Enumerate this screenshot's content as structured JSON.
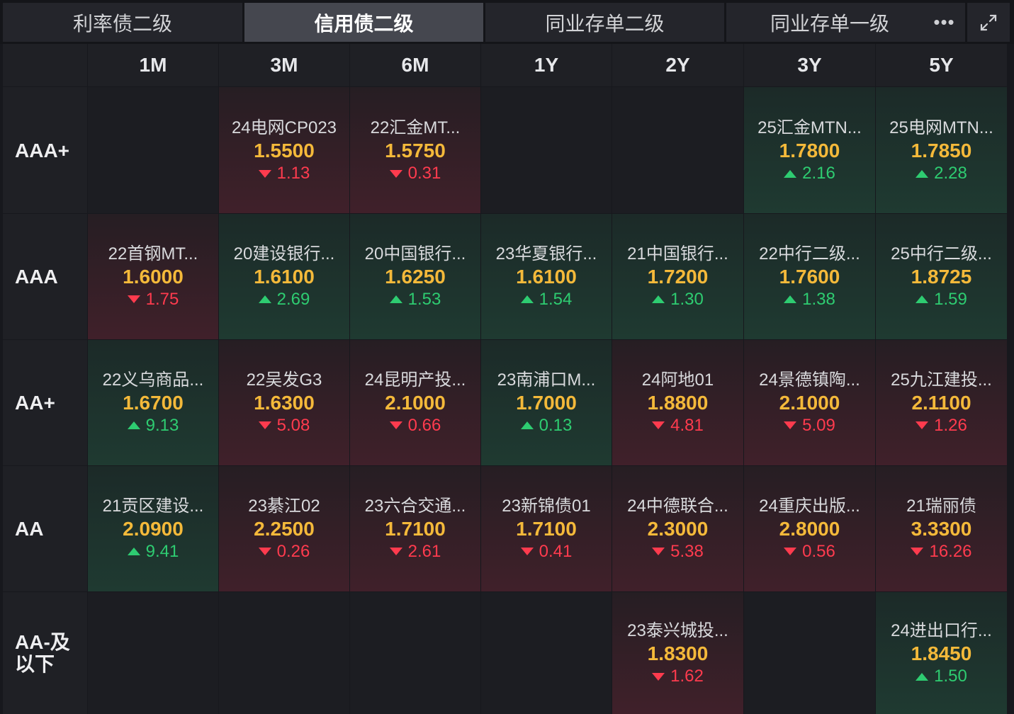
{
  "tabs": [
    "利率债二级",
    "信用债二级",
    "同业存单二级",
    "同业存单一级"
  ],
  "active_tab": 1,
  "more_label": "•••",
  "columns": [
    "1M",
    "3M",
    "6M",
    "1Y",
    "2Y",
    "3Y",
    "5Y"
  ],
  "rows": [
    {
      "label": "AAA+",
      "cells": [
        null,
        {
          "name": "24电网CP023",
          "value": "1.5500",
          "change": "1.13",
          "dir": "down"
        },
        {
          "name": "22汇金MT...",
          "value": "1.5750",
          "change": "0.31",
          "dir": "down"
        },
        null,
        null,
        {
          "name": "25汇金MTN...",
          "value": "1.7800",
          "change": "2.16",
          "dir": "up"
        },
        {
          "name": "25电网MTN...",
          "value": "1.7850",
          "change": "2.28",
          "dir": "up"
        }
      ]
    },
    {
      "label": "AAA",
      "cells": [
        {
          "name": "22首钢MT...",
          "value": "1.6000",
          "change": "1.75",
          "dir": "down"
        },
        {
          "name": "20建设银行...",
          "value": "1.6100",
          "change": "2.69",
          "dir": "up"
        },
        {
          "name": "20中国银行...",
          "value": "1.6250",
          "change": "1.53",
          "dir": "up"
        },
        {
          "name": "23华夏银行...",
          "value": "1.6100",
          "change": "1.54",
          "dir": "up"
        },
        {
          "name": "21中国银行...",
          "value": "1.7200",
          "change": "1.30",
          "dir": "up"
        },
        {
          "name": "22中行二级...",
          "value": "1.7600",
          "change": "1.38",
          "dir": "up"
        },
        {
          "name": "25中行二级...",
          "value": "1.8725",
          "change": "1.59",
          "dir": "up"
        }
      ]
    },
    {
      "label": "AA+",
      "cells": [
        {
          "name": "22义乌商品...",
          "value": "1.6700",
          "change": "9.13",
          "dir": "up"
        },
        {
          "name": "22吴发G3",
          "value": "1.6300",
          "change": "5.08",
          "dir": "down"
        },
        {
          "name": "24昆明产投...",
          "value": "2.1000",
          "change": "0.66",
          "dir": "down"
        },
        {
          "name": "23南浦口M...",
          "value": "1.7000",
          "change": "0.13",
          "dir": "up"
        },
        {
          "name": "24阿地01",
          "value": "1.8800",
          "change": "4.81",
          "dir": "down"
        },
        {
          "name": "24景德镇陶...",
          "value": "2.1000",
          "change": "5.09",
          "dir": "down"
        },
        {
          "name": "25九江建投...",
          "value": "2.1100",
          "change": "1.26",
          "dir": "down"
        }
      ]
    },
    {
      "label": "AA",
      "cells": [
        {
          "name": "21贡区建设...",
          "value": "2.0900",
          "change": "9.41",
          "dir": "up"
        },
        {
          "name": "23綦江02",
          "value": "2.2500",
          "change": "0.26",
          "dir": "down"
        },
        {
          "name": "23六合交通...",
          "value": "1.7100",
          "change": "2.61",
          "dir": "down"
        },
        {
          "name": "23新锦债01",
          "value": "1.7100",
          "change": "0.41",
          "dir": "down"
        },
        {
          "name": "24中德联合...",
          "value": "2.3000",
          "change": "5.38",
          "dir": "down"
        },
        {
          "name": "24重庆出版...",
          "value": "2.8000",
          "change": "0.56",
          "dir": "down"
        },
        {
          "name": "21瑞丽债",
          "value": "3.3300",
          "change": "16.26",
          "dir": "down"
        }
      ]
    },
    {
      "label": "AA-及以下",
      "cells": [
        null,
        null,
        null,
        null,
        {
          "name": "23泰兴城投...",
          "value": "1.8300",
          "change": "1.62",
          "dir": "down"
        },
        null,
        {
          "name": "24进出口行...",
          "value": "1.8450",
          "change": "1.50",
          "dir": "up"
        }
      ]
    }
  ],
  "colors": {
    "up": "#2ecc71",
    "down": "#ff3b4e",
    "value": "#f4b93a"
  },
  "icons": {
    "more": "ellipsis-icon",
    "expand": "expand-arrows-icon"
  }
}
